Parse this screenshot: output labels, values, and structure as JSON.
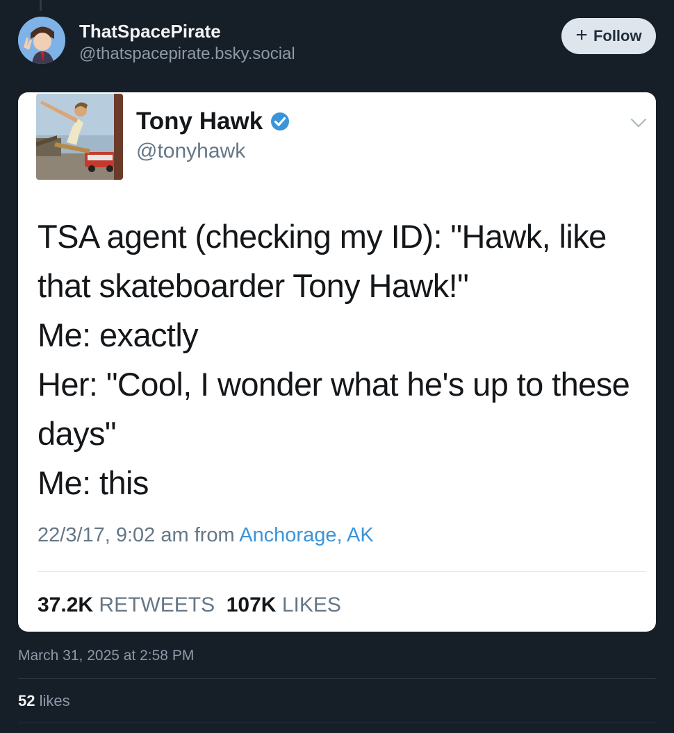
{
  "post": {
    "author_name": "ThatSpacePirate",
    "author_handle": "@thatspacepirate.bsky.social",
    "follow_label": "Follow",
    "date": "March 31, 2025 at 2:58 PM",
    "likes_count": "52",
    "likes_label": "likes"
  },
  "tweet": {
    "name": "Tony Hawk",
    "handle": "@tonyhawk",
    "lines": [
      "TSA agent (checking my ID): \"Hawk, like",
      "that skateboarder Tony Hawk!\"",
      "Me: exactly",
      "Her: \"Cool, I wonder what he's up to these",
      "days\"",
      "Me: this"
    ],
    "timestamp": "22/3/17, 9:02 am from",
    "location": "Anchorage, AK",
    "retweets_count": "37.2K",
    "retweets_label": "RETWEETS",
    "likes_count": "107K",
    "likes_label": "LIKES"
  },
  "colors": {
    "background": "#161e27",
    "link": "#3b94d9",
    "verified": "#3b94d9"
  },
  "icons": [
    "plus-icon",
    "verified-badge-icon",
    "chevron-down-icon"
  ]
}
